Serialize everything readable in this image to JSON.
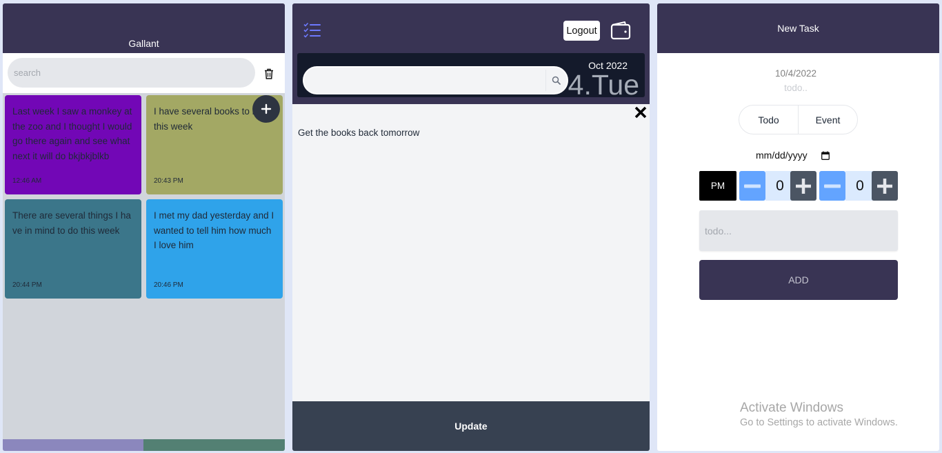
{
  "left_panel": {
    "title": "Gallant",
    "search_placeholder": "search",
    "trash_icon": "trash-icon",
    "add_icon": "plus-icon",
    "notes": [
      {
        "text": "Last week I saw a monkey at the zoo and I thought I would go there again and see what next it will do bkjbkjblkb",
        "time": "12:46 AM",
        "color": "#7207b6"
      },
      {
        "text": "I have several books to read this week",
        "time": "20:43 PM",
        "color": "#a3a864"
      },
      {
        "text": "There are several things I have in mind to do this week",
        "time": "20:44 PM",
        "color": "#3b768a"
      },
      {
        "text": "I met my dad yesterday and I wanted to tell him how much I love him",
        "time": "20:46 PM",
        "color": "#2fa3ea"
      }
    ],
    "footer_colors": [
      "#8b87bd",
      "#538073"
    ]
  },
  "middle_panel": {
    "checklist_icon": "checklist-icon",
    "logout_label": "Logout",
    "wallet_icon": "wallet-icon",
    "search_icon": "search-icon",
    "month_year": "Oct 2022",
    "day": "4.Tue",
    "close_icon": "close-icon",
    "note_text": "Get the books back tomorrow",
    "update_label": "Update"
  },
  "right_panel": {
    "title": "New Task",
    "date": "10/4/2022",
    "todo_hint": "todo..",
    "tabs": [
      "Todo",
      "Event"
    ],
    "date_input_placeholder": "mm/dd/yyyy",
    "calendar_icon": "calendar-icon",
    "meridiem": "PM",
    "hour_value": "0",
    "minute_value": "0",
    "todo_placeholder": "todo...",
    "add_label": "ADD"
  },
  "watermark": {
    "line1": "Activate Windows",
    "line2": "Go to Settings to activate Windows."
  },
  "colors": {
    "header": "#393454",
    "minus_button": "#63a4ff",
    "plus_button": "#4b5563",
    "update_bar": "#374151"
  }
}
